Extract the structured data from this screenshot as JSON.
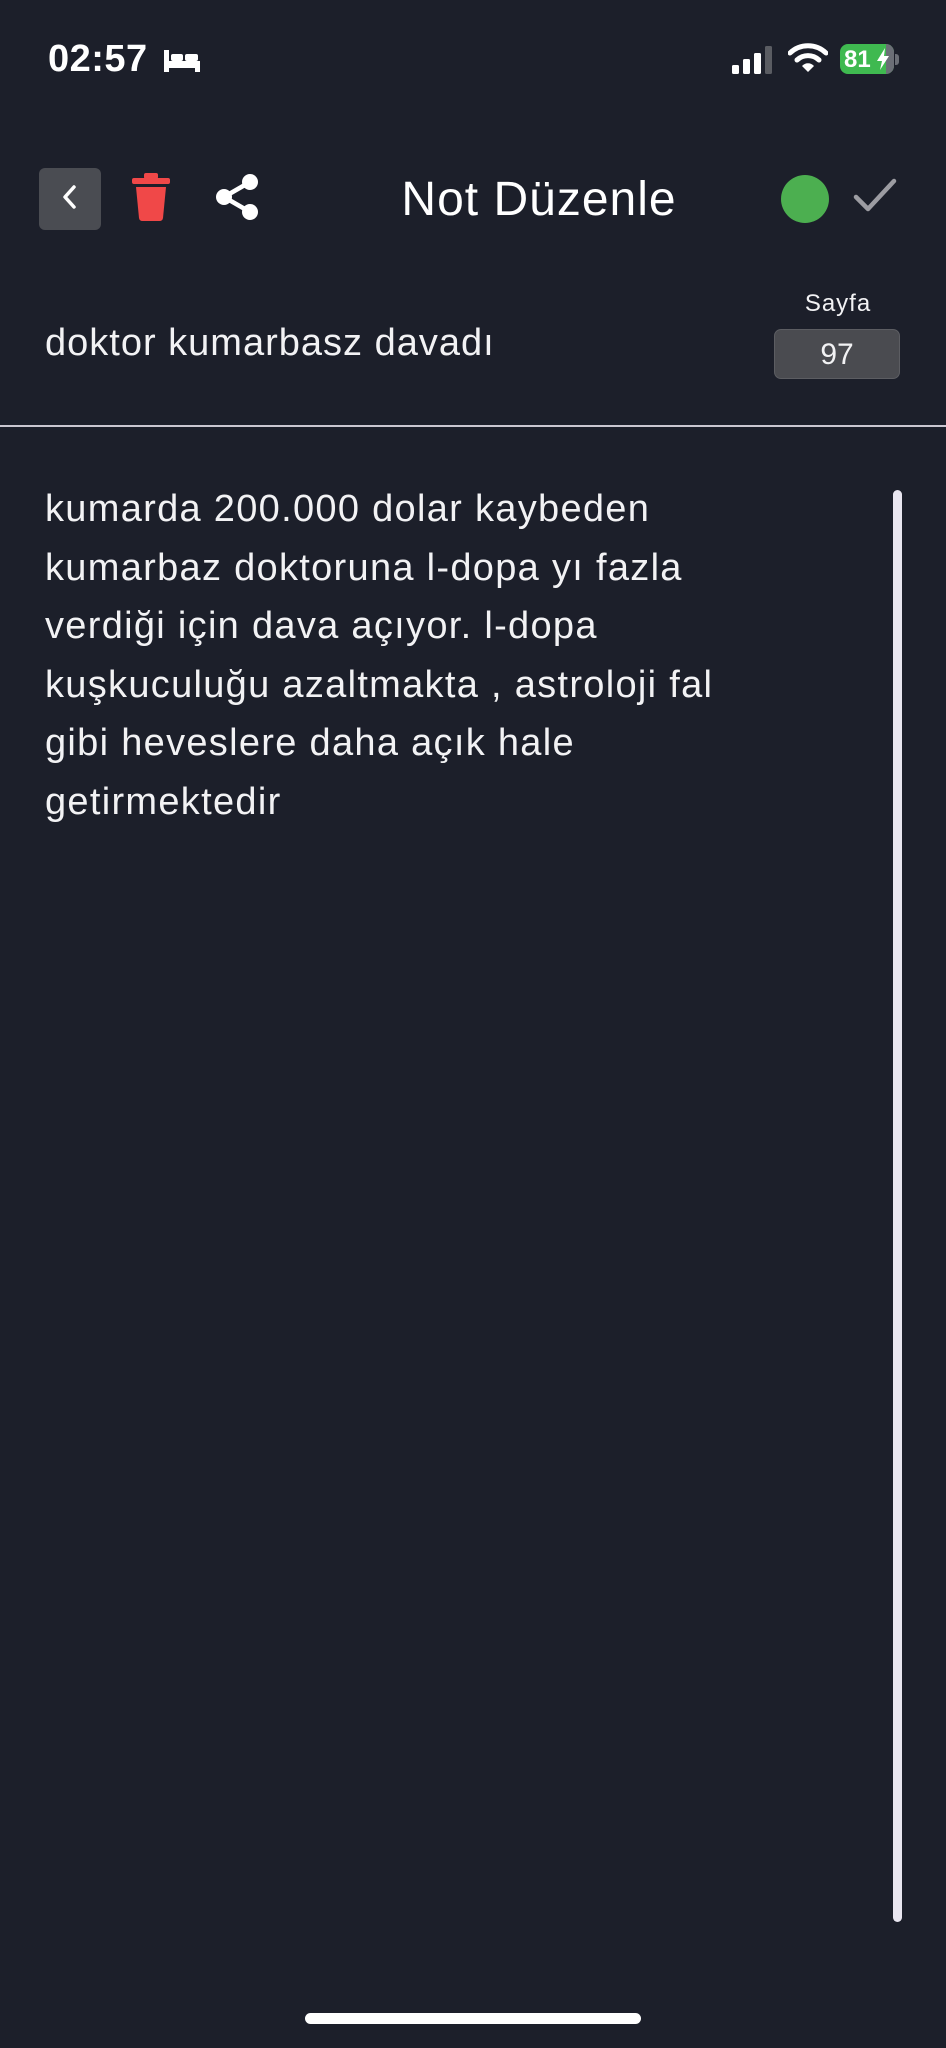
{
  "status_bar": {
    "time": "02:57",
    "battery_level": "81",
    "icons": [
      "bed-icon",
      "signal-icon",
      "wifi-icon",
      "battery-icon",
      "bolt-icon"
    ]
  },
  "toolbar": {
    "title": "Not Düzenle",
    "icons": [
      "chevron-left-icon",
      "trash-icon",
      "share-icon",
      "check-icon"
    ],
    "status_dot_color": "#4caf50",
    "delete_color": "#f04848"
  },
  "note": {
    "title": "doktor kumarbasz davadı",
    "page_label": "Sayfa",
    "page_number": "97",
    "body": "kumarda 200.000 dolar kaybeden\nkumarbaz doktoruna l-dopa yı fazla\nverdiği için dava açıyor. l-dopa\nkuşkuculuğu azaltmakta , astroloji fal\ngibi heveslere daha açık hale\ngetirmektedir"
  }
}
